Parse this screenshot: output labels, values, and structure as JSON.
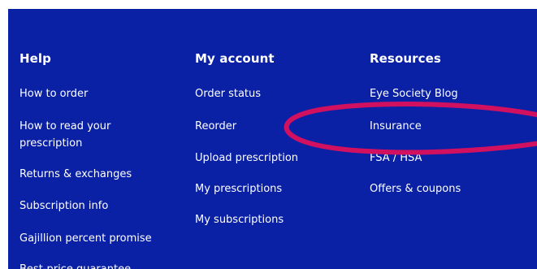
{
  "footer": {
    "help": {
      "heading": "Help",
      "links": [
        "How to order",
        "How to read your prescription",
        "Returns & exchanges",
        "Subscription info",
        "Gajillion percent promise",
        "Best-price guarantee"
      ]
    },
    "account": {
      "heading": "My account",
      "links": [
        "Order status",
        "Reorder",
        "Upload prescription",
        "My prescriptions",
        "My subscriptions"
      ]
    },
    "resources": {
      "heading": "Resources",
      "links": [
        "Eye Society Blog",
        "Insurance",
        "FSA / HSA",
        "Offers & coupons"
      ]
    }
  },
  "colors": {
    "background": "#0a21a6",
    "text": "#ffffff",
    "annotation": "#d21060"
  }
}
